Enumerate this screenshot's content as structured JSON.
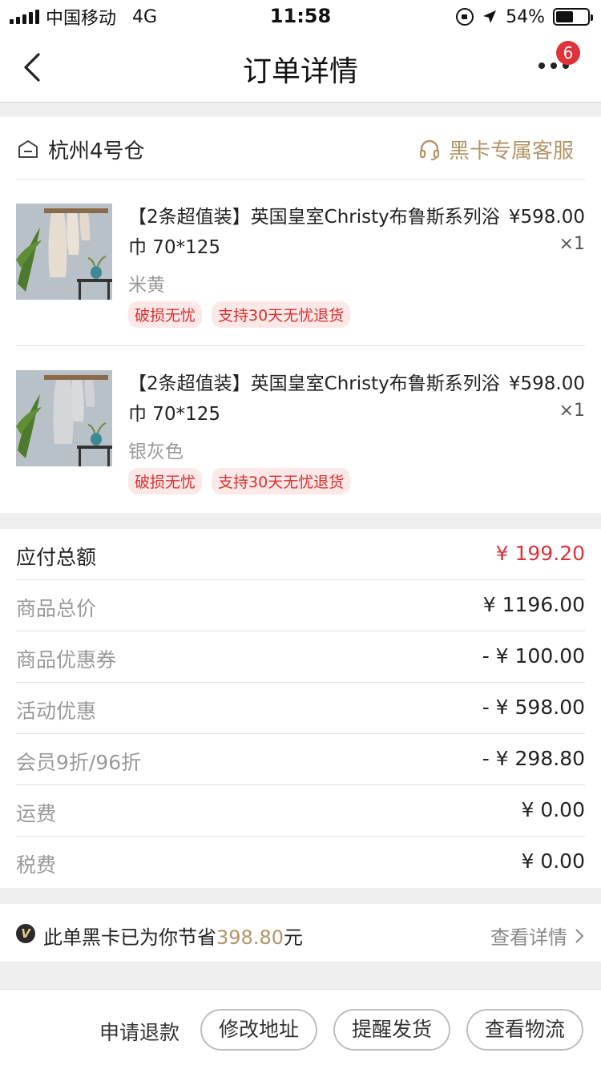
{
  "status_bar": {
    "carrier": "中国移动",
    "network": "4G",
    "time": "11:58",
    "battery": "54%",
    "battery_level": 0.54
  },
  "nav": {
    "title": "订单详情",
    "badge_count": "6"
  },
  "warehouse": {
    "name": "杭州4号仓",
    "service_label": "黑卡专属客服"
  },
  "items": [
    {
      "name": "【2条超值装】英国皇室Christy布鲁斯系列浴巾 70*125",
      "price": "¥598.00",
      "qty": "×1",
      "spec": "米黄",
      "tags": [
        "破损无忧",
        "支持30天无忧退货"
      ]
    },
    {
      "name": "【2条超值装】英国皇室Christy布鲁斯系列浴巾 70*125",
      "price": "¥598.00",
      "qty": "×1",
      "spec": "银灰色",
      "tags": [
        "破损无忧",
        "支持30天无忧退货"
      ]
    }
  ],
  "payment": {
    "rows": [
      {
        "label": "应付总额",
        "value": "¥ 199.20"
      },
      {
        "label": "商品总价",
        "value": "¥ 1196.00"
      },
      {
        "label": "商品优惠券",
        "value": "- ¥ 100.00"
      },
      {
        "label": "活动优惠",
        "value": "- ¥ 598.00"
      },
      {
        "label": "会员9折/96折",
        "value": "- ¥ 298.80"
      },
      {
        "label": "运费",
        "value": "¥ 0.00"
      },
      {
        "label": "税费",
        "value": "¥ 0.00"
      }
    ]
  },
  "savings": {
    "prefix": "此单黑卡已为你节省",
    "amount": "398.80",
    "suffix": "元",
    "link": "查看详情"
  },
  "actions": {
    "refund": "申请退款",
    "modify_address": "修改地址",
    "remind_ship": "提醒发货",
    "view_logistics": "查看物流"
  },
  "colors": {
    "accent_gold": "#b39466",
    "price_red": "#e0323a",
    "tag_bg": "#fde8e8"
  }
}
